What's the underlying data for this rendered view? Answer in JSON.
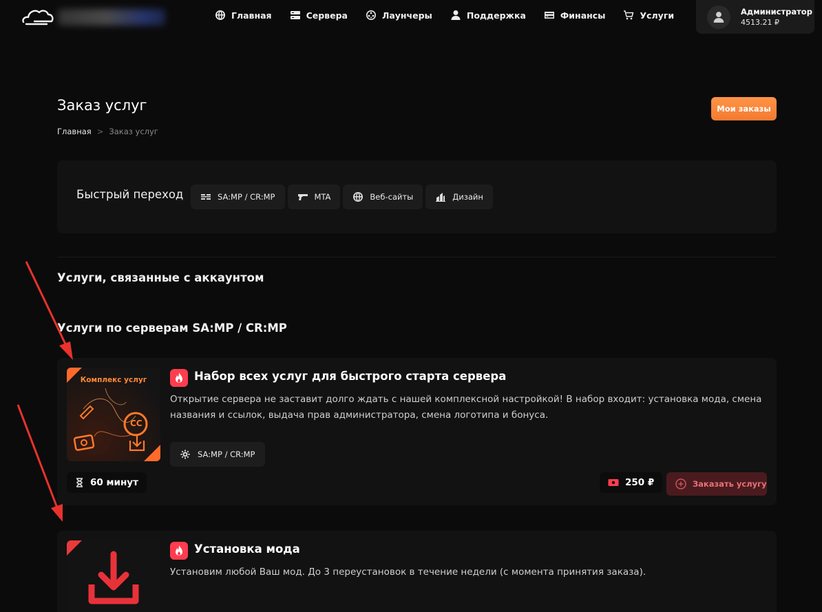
{
  "header": {
    "nav": [
      {
        "label": "Главная",
        "icon": "globe-icon"
      },
      {
        "label": "Сервера",
        "icon": "server-icon"
      },
      {
        "label": "Лаунчеры",
        "icon": "launcher-icon"
      },
      {
        "label": "Поддержка",
        "icon": "user-support-icon"
      },
      {
        "label": "Финансы",
        "icon": "card-icon"
      },
      {
        "label": "Услуги",
        "icon": "cart-icon"
      }
    ],
    "account": {
      "name": "Администратор",
      "balance": "4513.21 ₽"
    }
  },
  "page": {
    "title": "Заказ услуг",
    "breadcrumb": {
      "home": "Главная",
      "separator": ">",
      "current": "Заказ услуг"
    },
    "my_orders_label": "Мои заказы"
  },
  "quick_nav": {
    "label": "Быстрый переход",
    "chips": [
      {
        "label": "SA:MP / CR:MP",
        "icon": "samp-logo-icon"
      },
      {
        "label": "MTA",
        "icon": "pistol-icon"
      },
      {
        "label": "Веб-сайты",
        "icon": "globe-icon"
      },
      {
        "label": "Дизайн",
        "icon": "design-icon"
      }
    ]
  },
  "sections": {
    "account_services": "Услуги, связанные с аккаунтом",
    "samp_services": "Услуги по серверам SA:MP / CR:MP"
  },
  "cards": [
    {
      "image_caption": "Комплекс услуг",
      "title": "Набор всех услуг для быстрого старта сервера",
      "description": "Открытие сервера не заставит долго ждать с нашей комплексной настройкой! В набор входит: установка мода, смена названия и ссылок, выдача прав администратора, смена логотипа и бонуса.",
      "tag": "SA:MP / CR:MP",
      "duration": "60 минут",
      "price": "250 ₽",
      "order_label": "Заказать услугу"
    },
    {
      "title": "Установка мода",
      "description": "Установим любой Ваш мод. До 3 переустановок в течение недели (с момента принятия заказа)."
    }
  ],
  "colors": {
    "background": "#0b0b0b",
    "panel": "#121212",
    "accent_orange": "#f37a32",
    "accent_red": "#ff3d4f",
    "arrow_red": "#e8322c"
  }
}
